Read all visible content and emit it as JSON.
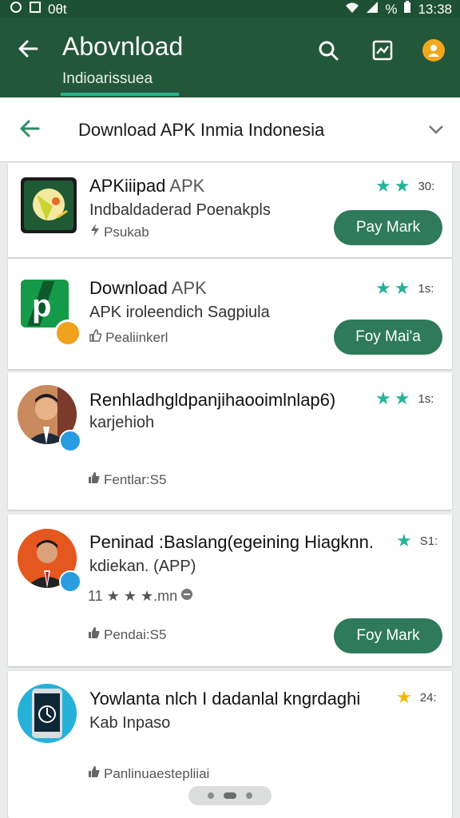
{
  "status_bar": {
    "left": "0θt",
    "battery": "%",
    "time": "13:38"
  },
  "app_bar": {
    "title": "Abovnload",
    "subtitle": "Indioarissuea"
  },
  "search": {
    "text": "Download APK Inmia  Indonesia"
  },
  "items": [
    {
      "title": "APKiiipad",
      "title_muted": "APK",
      "desc": "Indbaldaderad Poenakpls",
      "meta": "Psukab",
      "rating_count": "30:",
      "button": "Pay Mark"
    },
    {
      "title": "Download",
      "title_muted": "APK",
      "desc": "APK iroleendich Sagpiula",
      "meta": "Pealiinkerl",
      "rating_count": "1s:",
      "button": "Foy Mai'a"
    },
    {
      "title": "Renhladhgldpanjihaooimlnlap6)",
      "desc": "karjehioh",
      "meta": "Fentlar:S5",
      "rating_count": "1s:"
    },
    {
      "title": "Peninad :Baslang(egeining Hiagknn.",
      "desc": "kdiekan. (APP)",
      "meta_rating": "11 ★ ★ ★.mn",
      "meta": "Pendai:S5",
      "rating_count": "S1:",
      "button": "Foy Mark"
    },
    {
      "title": "Yowlanta nlch I dadanlal kngrdaghi",
      "desc": "Kab Inpaso",
      "meta": "Panlinuaestepliiai",
      "rating_count": "24:"
    }
  ],
  "colors": {
    "appbar": "#23573a",
    "accent": "#27b38a",
    "button": "#2e7a5b",
    "star_teal": "#26b39a",
    "star_gold": "#f2b705"
  }
}
